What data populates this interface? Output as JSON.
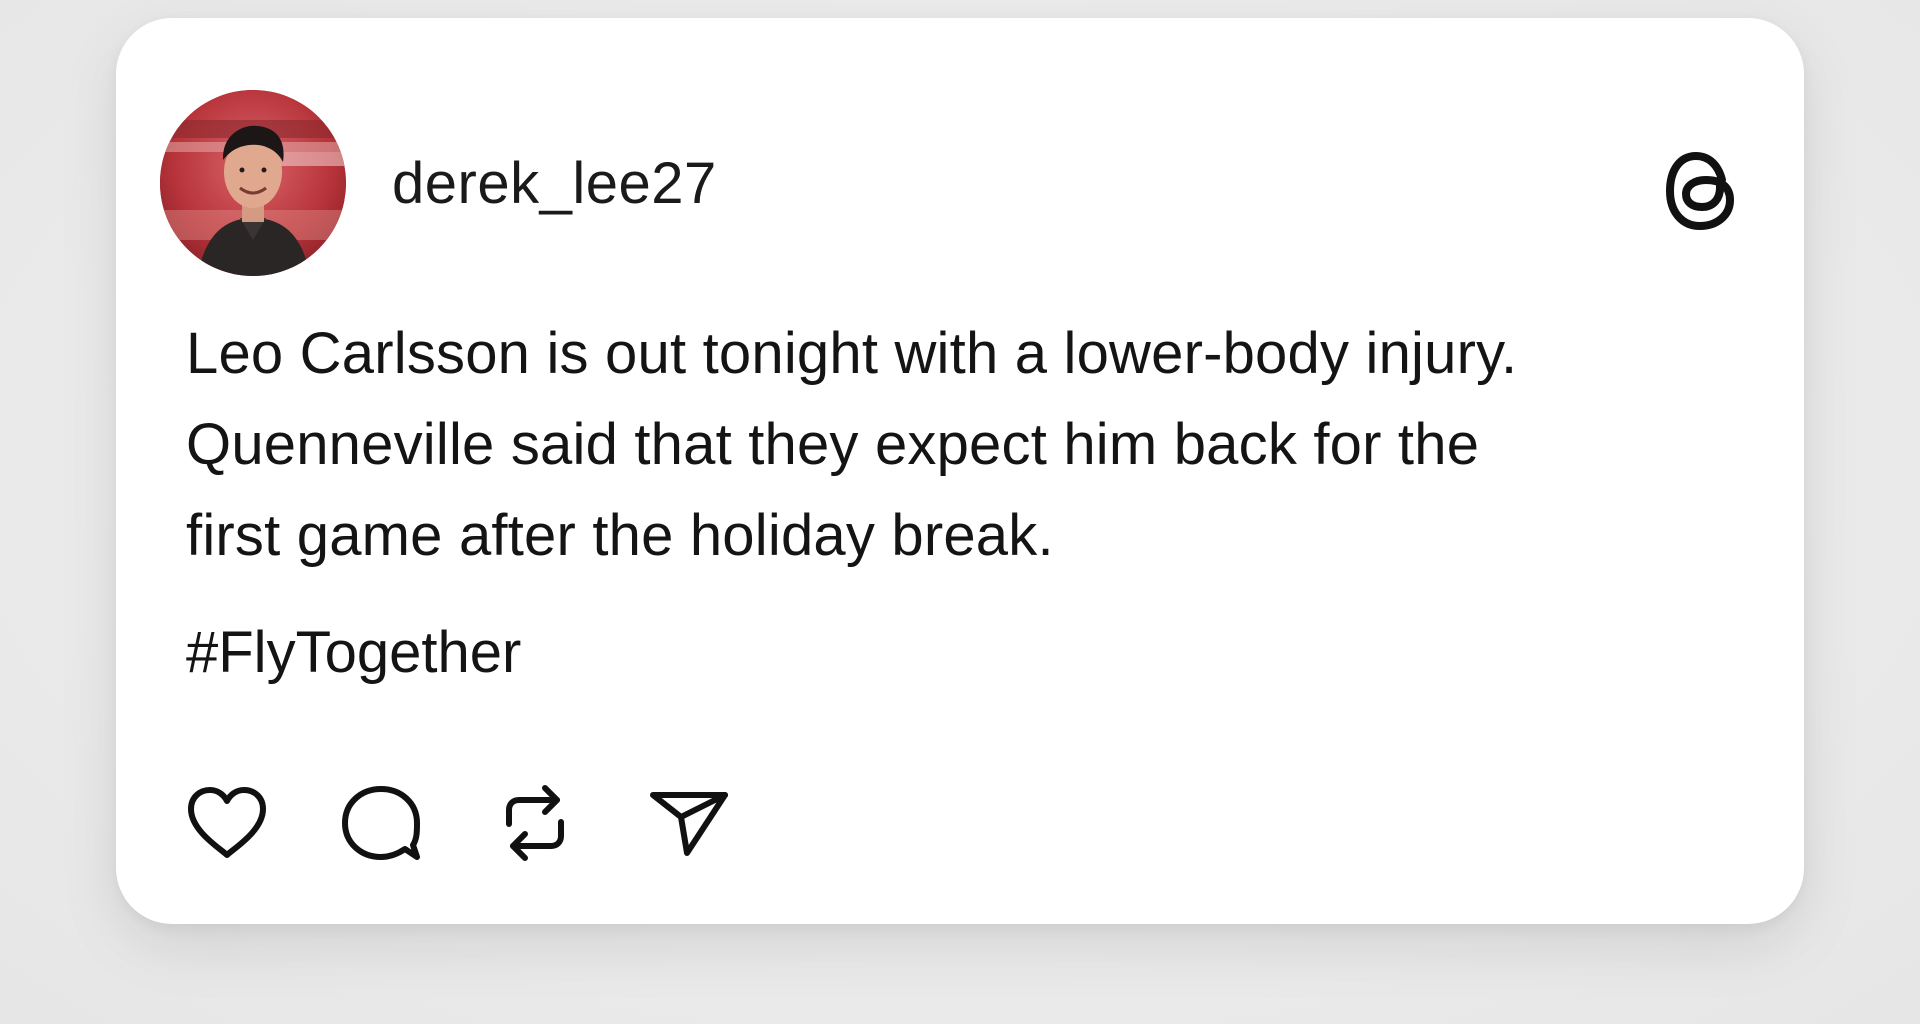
{
  "post": {
    "username": "derek_lee27",
    "avatar_icon": "user-avatar-photo",
    "app_icon": "threads-logo-icon",
    "body_lines": [
      "Leo Carlsson is out tonight with a lower-body injury.",
      "Quenneville said that they expect him back for the",
      "first game after the holiday break."
    ],
    "hashtag": "#FlyTogether"
  },
  "actions": [
    {
      "name": "like",
      "icon": "heart-icon"
    },
    {
      "name": "comment",
      "icon": "comment-bubble-icon"
    },
    {
      "name": "repost",
      "icon": "repost-arrows-icon"
    },
    {
      "name": "share",
      "icon": "send-paper-plane-icon"
    }
  ],
  "colors": {
    "background": "#ececec",
    "card": "#ffffff",
    "text": "#141414",
    "avatar_accent": "#a4242c"
  }
}
